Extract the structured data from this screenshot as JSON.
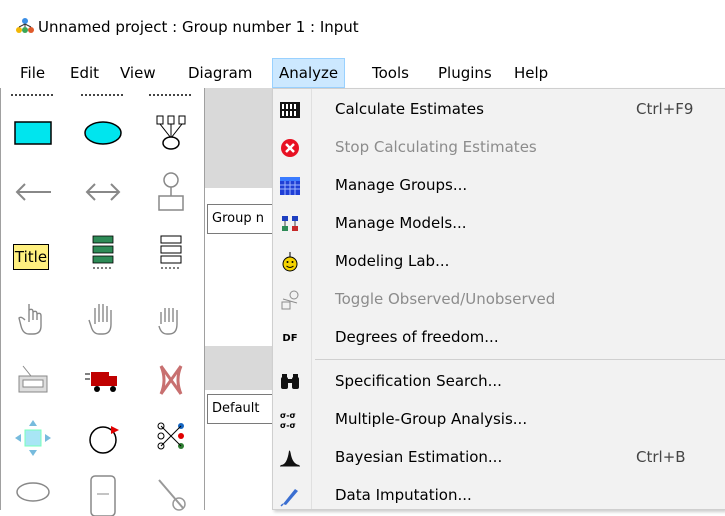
{
  "window": {
    "title": "Unnamed project : Group number 1 : Input"
  },
  "menubar": {
    "items": [
      "File",
      "Edit",
      "View",
      "Diagram",
      "Analyze",
      "Tools",
      "Plugins",
      "Help"
    ],
    "active": "Analyze"
  },
  "workspace": {
    "panel1_text": "Group n",
    "panel2_text": "Default"
  },
  "toolbox": {
    "title_tool_label": "Title"
  },
  "analyze_menu": {
    "items": [
      {
        "icon": "calculate-icon",
        "label": "Calculate Estimates",
        "shortcut": "Ctrl+F9",
        "enabled": true
      },
      {
        "icon": "stop-icon",
        "label": "Stop Calculating Estimates",
        "shortcut": "",
        "enabled": false
      },
      {
        "icon": "groups-icon",
        "label": "Manage Groups...",
        "shortcut": "",
        "enabled": true
      },
      {
        "icon": "models-icon",
        "label": "Manage Models...",
        "shortcut": "",
        "enabled": true
      },
      {
        "icon": "modeling-lab-icon",
        "label": "Modeling Lab...",
        "shortcut": "",
        "enabled": true
      },
      {
        "icon": "toggle-observed-icon",
        "label": "Toggle Observed/Unobserved",
        "shortcut": "",
        "enabled": false
      },
      {
        "icon": "df-icon",
        "label": "Degrees of freedom...",
        "shortcut": "",
        "enabled": true,
        "icon_text": "DF"
      },
      {
        "icon": "binoculars-icon",
        "label": "Specification Search...",
        "shortcut": "",
        "enabled": true
      },
      {
        "icon": "multi-group-icon",
        "label": "Multiple-Group Analysis...",
        "shortcut": "",
        "enabled": true
      },
      {
        "icon": "bayesian-icon",
        "label": "Bayesian Estimation...",
        "shortcut": "Ctrl+B",
        "enabled": true
      },
      {
        "icon": "imputation-icon",
        "label": "Data Imputation...",
        "shortcut": "",
        "enabled": true
      }
    ]
  },
  "colors": {
    "menu_active_bg": "#cce8ff",
    "stop_red": "#e81123",
    "disabled_text": "#8c8c8c"
  }
}
